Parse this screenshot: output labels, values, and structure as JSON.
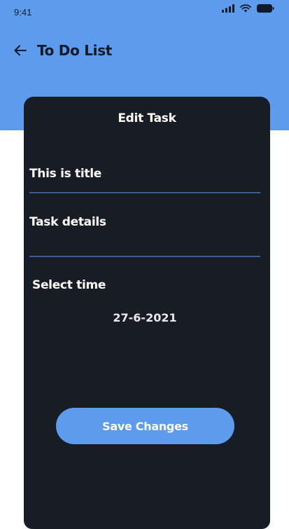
{
  "status_bar": {
    "time": "9:41",
    "icons": [
      "cellular-signal-icon",
      "wifi-icon",
      "battery-icon"
    ]
  },
  "app_bar": {
    "back_icon": "arrow-left-icon",
    "title": "To Do List"
  },
  "card": {
    "title": "Edit Task",
    "title_field_value": "This is title",
    "details_field_value": "Task details",
    "select_time_label": "Select time",
    "date_value": "27-6-2021",
    "save_button_label": "Save Changes"
  },
  "colors": {
    "header_blue": "#5d9bec",
    "card_background": "#181c24",
    "field_underline": "#3a5f8f",
    "button_blue": "#5d9bec",
    "title_text": "#111827"
  }
}
